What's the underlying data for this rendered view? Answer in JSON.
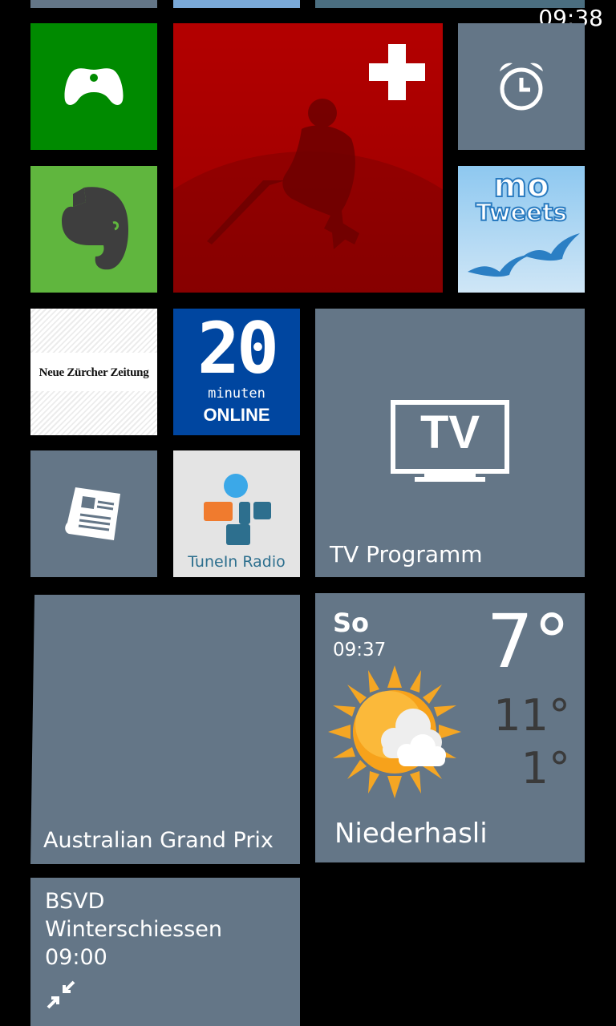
{
  "status_bar": {
    "time": "09:38"
  },
  "colors": {
    "xbox_green": "#008A00",
    "evernote_green": "#60B63E",
    "sport_red": "#A80000",
    "slate": "#647687",
    "news20_blue": "#0046A0"
  },
  "tiles": {
    "xbox": {
      "icon": "gamepad-icon"
    },
    "sport": {
      "icon": "swiss-cross-icon"
    },
    "alarms": {
      "icon": "alarm-clock-icon"
    },
    "evernote": {
      "icon": "elephant-icon"
    },
    "motweets": {
      "line1": "mo",
      "line2": "Tweets"
    },
    "nzz": {
      "label": "Neue Zürcher Zeitung"
    },
    "news20": {
      "number": "20",
      "sub": "minuten",
      "brand": "ONLINE"
    },
    "tv": {
      "glyph": "TV",
      "label": "TV Programm"
    },
    "news_reader": {
      "icon": "newspaper-icon"
    },
    "tunein": {
      "label": "TuneIn Radio"
    },
    "race": {
      "label": "Australian Grand Prix"
    },
    "weather": {
      "day": "So",
      "time": "09:37",
      "temp": "7°",
      "high": "11°",
      "low": "1°",
      "location": "Niederhasli",
      "icon": "sun-cloud-icon"
    },
    "calendar": {
      "line1": "BSVD",
      "line2": "Winterschiessen",
      "line3": "09:00",
      "icon": "collapse-arrows-icon"
    }
  }
}
